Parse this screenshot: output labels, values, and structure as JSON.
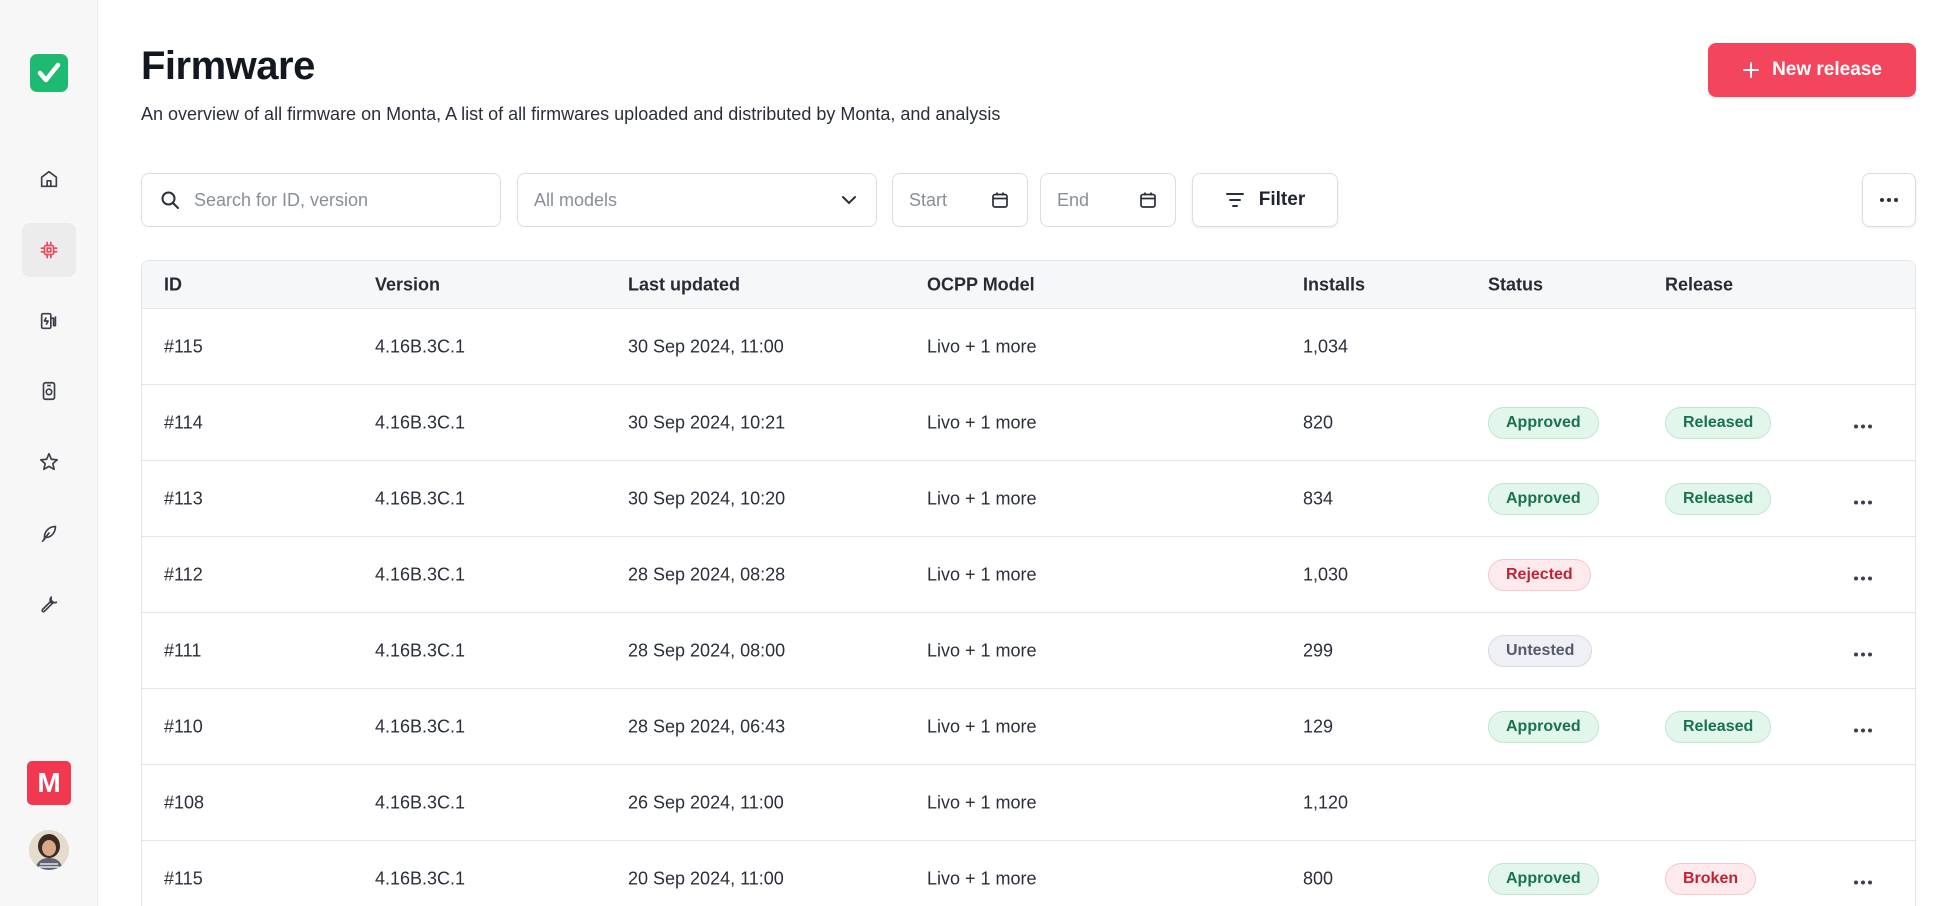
{
  "page": {
    "title": "Firmware",
    "subtitle": "An overview of all firmware on Monta, A list of all firmwares uploaded and distributed by Monta, and analysis",
    "new_release_label": "New release"
  },
  "sidebar": {
    "brand_letter": "M",
    "items": [
      {
        "name": "home-icon"
      },
      {
        "name": "chip-icon",
        "active": true
      },
      {
        "name": "charger-icon"
      },
      {
        "name": "device-icon"
      },
      {
        "name": "star-icon"
      },
      {
        "name": "feather-icon"
      },
      {
        "name": "wrench-icon"
      }
    ]
  },
  "toolbar": {
    "search_placeholder": "Search for ID, version",
    "models_selected": "All models",
    "start_placeholder": "Start",
    "end_placeholder": "End",
    "filter_label": "Filter"
  },
  "table": {
    "headers": {
      "id": "ID",
      "version": "Version",
      "last_updated": "Last updated",
      "ocpp_model": "OCPP Model",
      "installs": "Installs",
      "status": "Status",
      "release": "Release"
    },
    "rows": [
      {
        "id": "#115",
        "version": "4.16B.3C.1",
        "updated": "30 Sep 2024, 11:00",
        "ocpp": "Livo + 1 more",
        "installs": "1,034",
        "status": "",
        "release": "",
        "actions": false
      },
      {
        "id": "#114",
        "version": "4.16B.3C.1",
        "updated": "30 Sep 2024, 10:21",
        "ocpp": "Livo + 1 more",
        "installs": "820",
        "status": "Approved",
        "release": "Released",
        "actions": true
      },
      {
        "id": "#113",
        "version": "4.16B.3C.1",
        "updated": "30 Sep 2024, 10:20",
        "ocpp": "Livo + 1 more",
        "installs": "834",
        "status": "Approved",
        "release": "Released",
        "actions": true
      },
      {
        "id": "#112",
        "version": "4.16B.3C.1",
        "updated": "28 Sep 2024, 08:28",
        "ocpp": "Livo + 1 more",
        "installs": "1,030",
        "status": "Rejected",
        "release": "",
        "actions": true
      },
      {
        "id": "#111",
        "version": "4.16B.3C.1",
        "updated": "28 Sep 2024, 08:00",
        "ocpp": "Livo + 1 more",
        "installs": "299",
        "status": "Untested",
        "release": "",
        "actions": true
      },
      {
        "id": "#110",
        "version": "4.16B.3C.1",
        "updated": "28 Sep 2024, 06:43",
        "ocpp": "Livo + 1 more",
        "installs": "129",
        "status": "Approved",
        "release": "Released",
        "actions": true
      },
      {
        "id": "#108",
        "version": "4.16B.3C.1",
        "updated": "26 Sep 2024, 11:00",
        "ocpp": "Livo + 1 more",
        "installs": "1,120",
        "status": "",
        "release": "",
        "actions": false
      },
      {
        "id": "#115",
        "version": "4.16B.3C.1",
        "updated": "20 Sep 2024, 11:00",
        "ocpp": "Livo + 1 more",
        "installs": "800",
        "status": "Approved",
        "release": "Broken",
        "actions": true
      }
    ]
  },
  "colors": {
    "accent": "#f3465c",
    "logo_green": "#1fba72",
    "approved": "#17734a",
    "rejected": "#c02336",
    "untested": "#535a6a"
  }
}
